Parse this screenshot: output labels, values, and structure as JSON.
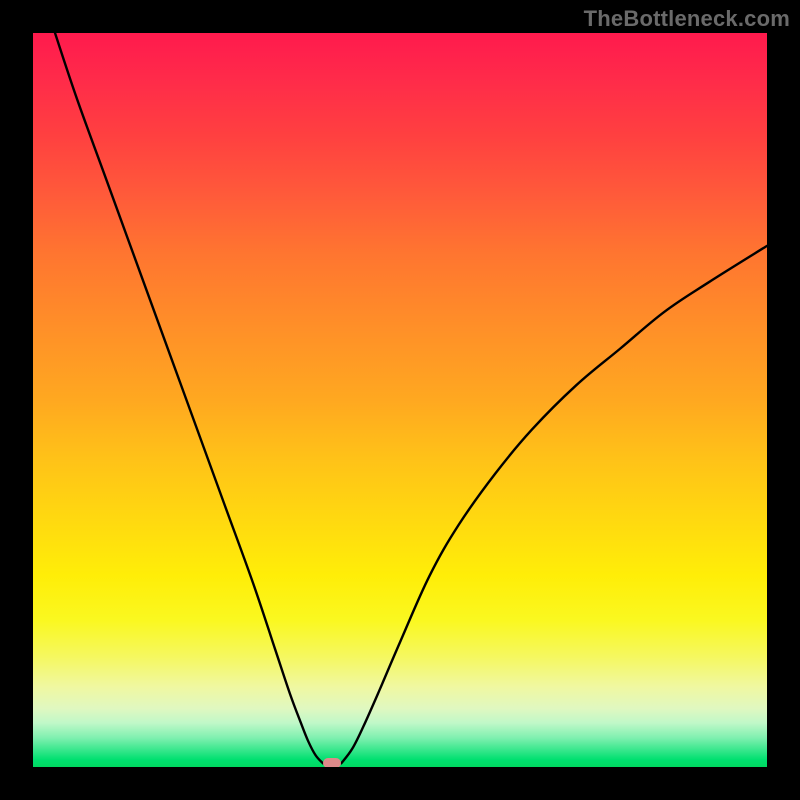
{
  "watermark": "TheBottleneck.com",
  "chart_data": {
    "type": "line",
    "title": "",
    "xlabel": "",
    "ylabel": "",
    "xlim": [
      0,
      100
    ],
    "ylim": [
      0,
      100
    ],
    "grid": false,
    "series": [
      {
        "name": "left-branch",
        "x": [
          3,
          6,
          10,
          14,
          18,
          22,
          26,
          30,
          33,
          35,
          36.5,
          37.5,
          38.5,
          39.5
        ],
        "values": [
          100,
          91,
          80,
          69,
          58,
          47,
          36,
          25,
          16,
          10,
          6,
          3.5,
          1.6,
          0.5
        ]
      },
      {
        "name": "right-branch",
        "x": [
          42,
          43.5,
          45,
          47,
          50,
          54,
          58,
          63,
          68,
          74,
          80,
          86,
          92,
          100
        ],
        "values": [
          0.5,
          2.5,
          5.5,
          10,
          17,
          26,
          33,
          40,
          46,
          52,
          57,
          62,
          66,
          71
        ]
      }
    ],
    "marker": {
      "x": 40.8,
      "y": 0.5
    },
    "background_gradient": {
      "top": "#ff1a4d",
      "mid": "#ffc218",
      "bottom": "#00d860"
    }
  }
}
